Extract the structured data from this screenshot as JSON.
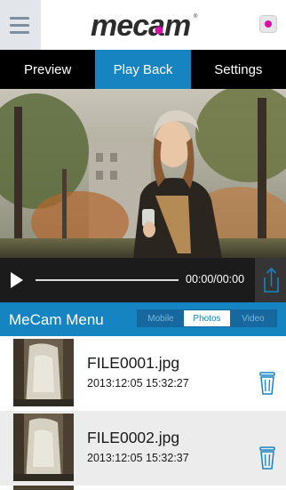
{
  "header": {
    "logo_text": "mecam",
    "menu_icon": "hamburger-icon",
    "record_icon": "record-icon"
  },
  "tabs": [
    {
      "label": "Preview",
      "active": false
    },
    {
      "label": "Play Back",
      "active": true
    },
    {
      "label": "Settings",
      "active": false
    }
  ],
  "player": {
    "time": "00:00/00:00",
    "progress": 0,
    "play_icon": "play-icon",
    "share_icon": "share-icon"
  },
  "menu": {
    "title": "MeCam Menu",
    "segments": [
      {
        "label": "Mobile",
        "active": false
      },
      {
        "label": "Photos",
        "active": true
      },
      {
        "label": "Video",
        "active": false
      }
    ]
  },
  "files": [
    {
      "name": "FILE0001.jpg",
      "date": "2013:12:05 15:32:27"
    },
    {
      "name": "FILE0002.jpg",
      "date": "2013:12:05 15:32:37"
    }
  ],
  "colors": {
    "accent": "#1784c2",
    "record": "#d90fa8",
    "trash": "#1784c2"
  }
}
